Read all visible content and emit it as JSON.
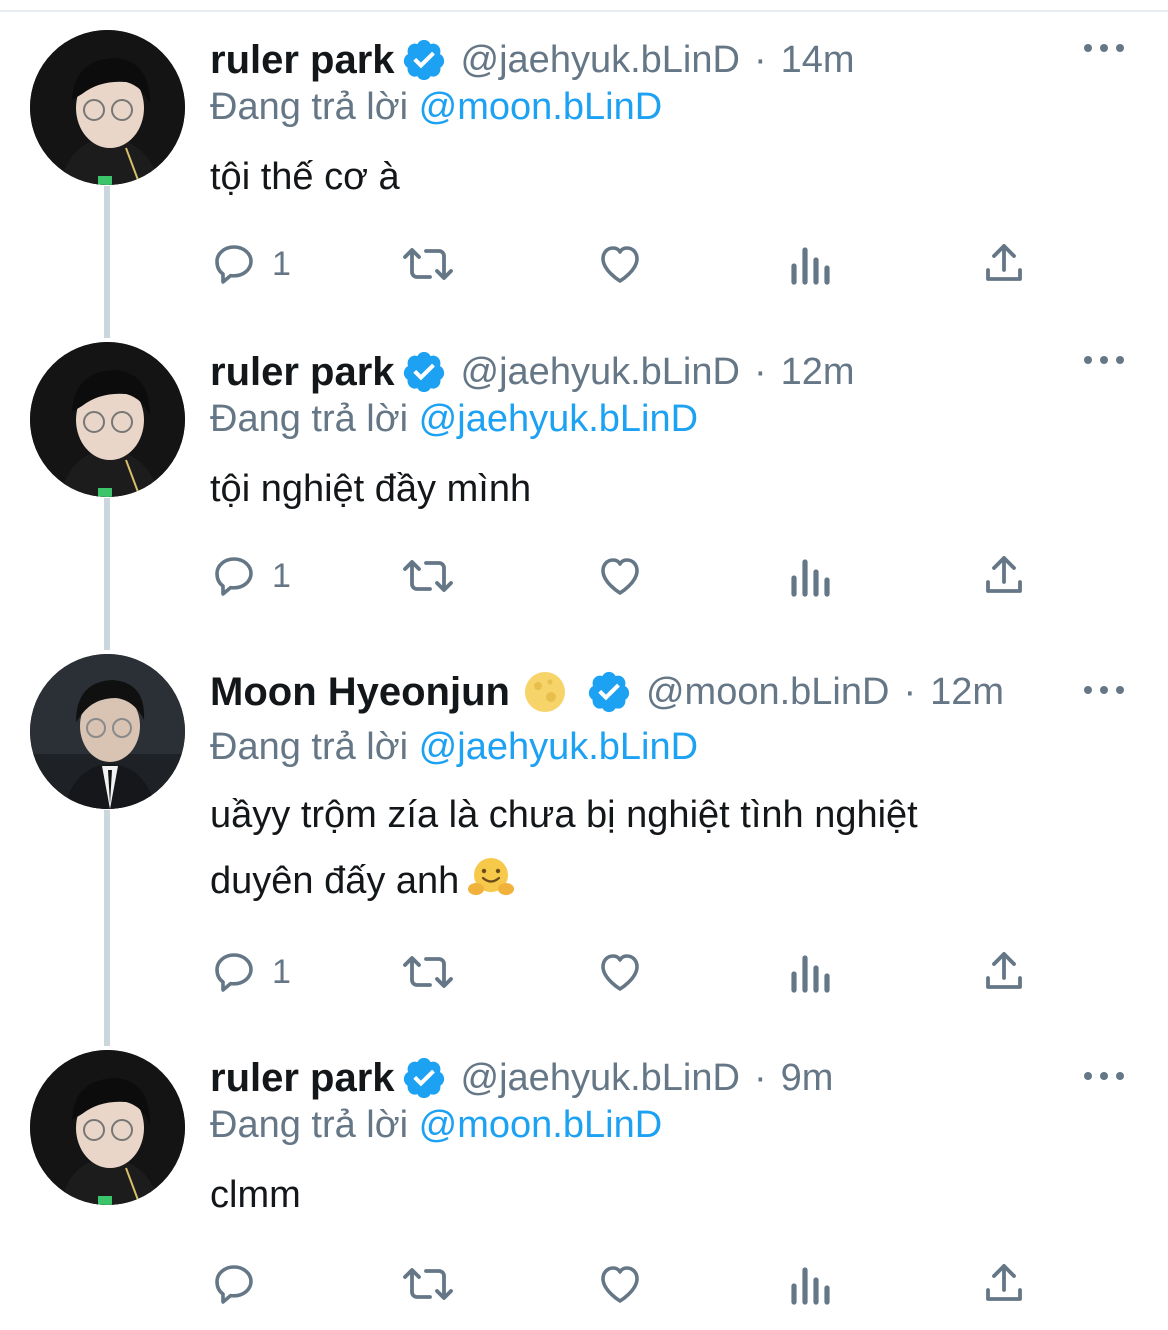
{
  "tweets": [
    {
      "name": "ruler park",
      "handle": "@jaehyuk.bLinD",
      "time": "14m",
      "reply_prefix": "Đang trả lời",
      "reply_mention": "@moon.bLinD",
      "text": "tội thế cơ à",
      "reply_count": "1",
      "avatar": "ruler-avatar"
    },
    {
      "name": "ruler park",
      "handle": "@jaehyuk.bLinD",
      "time": "12m",
      "reply_prefix": "Đang trả lời",
      "reply_mention": "@jaehyuk.bLinD",
      "text": "tội nghiệt đầy mình",
      "reply_count": "1",
      "avatar": "ruler-avatar"
    },
    {
      "name": "Moon Hyeonjun",
      "name_emoji": "full-moon-emoji",
      "handle": "@moon.bLinD",
      "time": "12m",
      "reply_prefix": "Đang trả lời",
      "reply_mention": "@jaehyuk.bLinD",
      "text_line1": "uầyy trộm zía là chưa bị nghiệt tình nghiệt",
      "text_line2": "duyên đấy anh",
      "text_emoji": "hugging-face-emoji",
      "reply_count": "1",
      "avatar": "moon-avatar"
    },
    {
      "name": "ruler park",
      "handle": "@jaehyuk.bLinD",
      "time": "9m",
      "reply_prefix": "Đang trả lời",
      "reply_mention": "@moon.bLinD",
      "text": "clmm",
      "reply_count": "",
      "avatar": "ruler-avatar"
    }
  ],
  "icons": {
    "reply": "reply-icon",
    "retweet": "retweet-icon",
    "like": "heart-icon",
    "analytics": "analytics-icon",
    "share": "share-icon",
    "verified": "verified-badge-icon",
    "more": "more-dots-icon"
  },
  "colors": {
    "mention": "#1da1f2",
    "secondary_text": "#657786",
    "verified": "#1da1f2",
    "thread_line": "#ccd6dd"
  },
  "separator": "·"
}
